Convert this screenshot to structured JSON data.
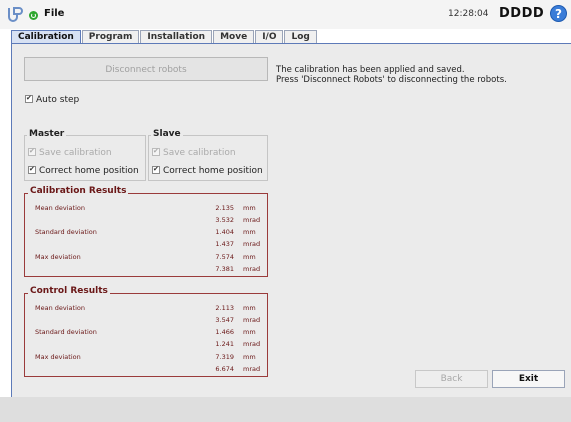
{
  "header": {
    "logo_icon": "universal-robots-logo-icon",
    "status_icon": "status-running-icon",
    "file_menu": "File",
    "clock": "12:28:04",
    "robot_name": "DDDD",
    "help_glyph": "?"
  },
  "tabs": [
    {
      "label": "Calibration",
      "active": true
    },
    {
      "label": "Program"
    },
    {
      "label": "Installation"
    },
    {
      "label": "Move"
    },
    {
      "label": "I/O"
    },
    {
      "label": "Log"
    }
  ],
  "main": {
    "disconnect_label": "Disconnect robots",
    "message_line1": "The calibration has been applied and saved.",
    "message_line2": "Press 'Disconnect Robots' to disconnecting the robots.",
    "auto_step": {
      "label": "Auto step",
      "checked": true
    },
    "master": {
      "title": "Master",
      "save_calibration": {
        "label": "Save calibration",
        "checked": true,
        "enabled": false
      },
      "correct_home": {
        "label": "Correct home position",
        "checked": true,
        "enabled": true
      }
    },
    "slave": {
      "title": "Slave",
      "save_calibration": {
        "label": "Save calibration",
        "checked": true,
        "enabled": false
      },
      "correct_home": {
        "label": "Correct home position",
        "checked": true,
        "enabled": true
      }
    },
    "calibration_results": {
      "title": "Calibration Results",
      "rows": [
        {
          "label": "Mean deviation",
          "value": "2.135",
          "unit": "mm"
        },
        {
          "label": "",
          "value": "3.532",
          "unit": "mrad"
        },
        {
          "label": "Standard deviation",
          "value": "1.404",
          "unit": "mm"
        },
        {
          "label": "",
          "value": "1.437",
          "unit": "mrad"
        },
        {
          "label": "Max deviation",
          "value": "7.574",
          "unit": "mm"
        },
        {
          "label": "",
          "value": "7.381",
          "unit": "mrad"
        }
      ]
    },
    "control_results": {
      "title": "Control Results",
      "rows": [
        {
          "label": "Mean deviation",
          "value": "2.113",
          "unit": "mm"
        },
        {
          "label": "",
          "value": "3.547",
          "unit": "mrad"
        },
        {
          "label": "Standard deviation",
          "value": "1.466",
          "unit": "mm"
        },
        {
          "label": "",
          "value": "1.241",
          "unit": "mrad"
        },
        {
          "label": "Max deviation",
          "value": "7.319",
          "unit": "mm"
        },
        {
          "label": "",
          "value": "6.674",
          "unit": "mrad"
        }
      ]
    },
    "back_label": "Back",
    "exit_label": "Exit"
  }
}
